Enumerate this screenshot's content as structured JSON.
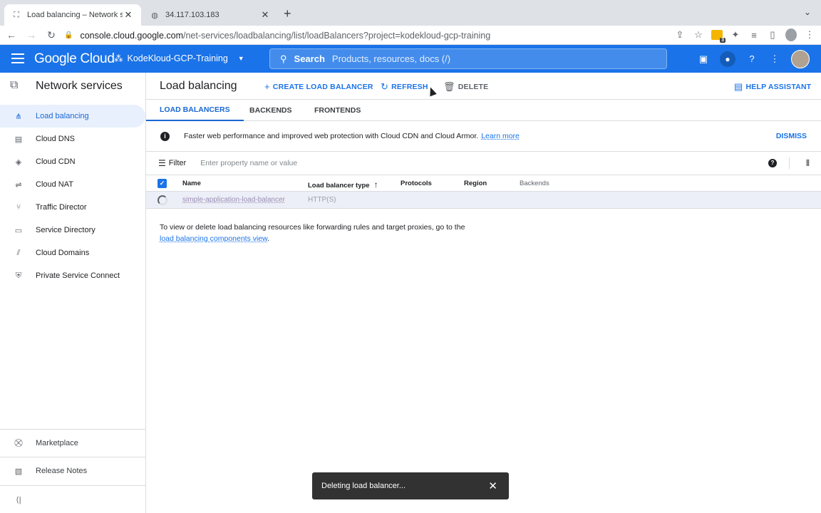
{
  "browser": {
    "tabs": [
      {
        "title": "Load balancing – Network serv",
        "active": true,
        "favicon": "network-icon"
      },
      {
        "title": "34.117.103.183",
        "active": false,
        "favicon": "globe-icon"
      }
    ],
    "new_tab": "+",
    "url_host": "console.cloud.google.com",
    "url_path": "/net-services/loadbalancing/list/loadBalancers?project=kodekloud-gcp-training",
    "extension_badge": "3"
  },
  "gcp_header": {
    "logo": "Google Cloud",
    "project": "KodeKloud-GCP-Training",
    "search_label": "Search",
    "search_placeholder": "Products, resources, docs (/)"
  },
  "sidebar": {
    "title": "Network services",
    "items": [
      {
        "label": "Load balancing",
        "icon": "load-balancing-icon",
        "active": true
      },
      {
        "label": "Cloud DNS",
        "icon": "dns-icon"
      },
      {
        "label": "Cloud CDN",
        "icon": "cdn-icon"
      },
      {
        "label": "Cloud NAT",
        "icon": "nat-icon"
      },
      {
        "label": "Traffic Director",
        "icon": "traffic-director-icon"
      },
      {
        "label": "Service Directory",
        "icon": "service-directory-icon"
      },
      {
        "label": "Cloud Domains",
        "icon": "domains-icon"
      },
      {
        "label": "Private Service Connect",
        "icon": "private-service-connect-icon"
      }
    ],
    "marketplace": "Marketplace",
    "release_notes": "Release Notes"
  },
  "main": {
    "title": "Load balancing",
    "actions": {
      "create": "CREATE LOAD BALANCER",
      "refresh": "REFRESH",
      "delete": "DELETE",
      "help": "HELP ASSISTANT"
    },
    "tabs": [
      "LOAD BALANCERS",
      "BACKENDS",
      "FRONTENDS"
    ],
    "banner": {
      "text": "Faster web performance and improved web protection with Cloud CDN and Cloud Armor.",
      "link": "Learn more",
      "dismiss": "DISMISS"
    },
    "filter": {
      "label": "Filter",
      "placeholder": "Enter property name or value"
    },
    "table": {
      "columns": [
        "Name",
        "Load balancer type",
        "Protocols",
        "Region",
        "Backends"
      ],
      "rows": [
        {
          "name": "simple-application-load-balancer",
          "type": "HTTP(S)"
        }
      ]
    },
    "note_text": "To view or delete load balancing resources like forwarding rules and target proxies, go to the",
    "note_link": "load balancing components view",
    "note_end": "."
  },
  "toast": {
    "message": "Deleting load balancer...",
    "close": "✕"
  }
}
